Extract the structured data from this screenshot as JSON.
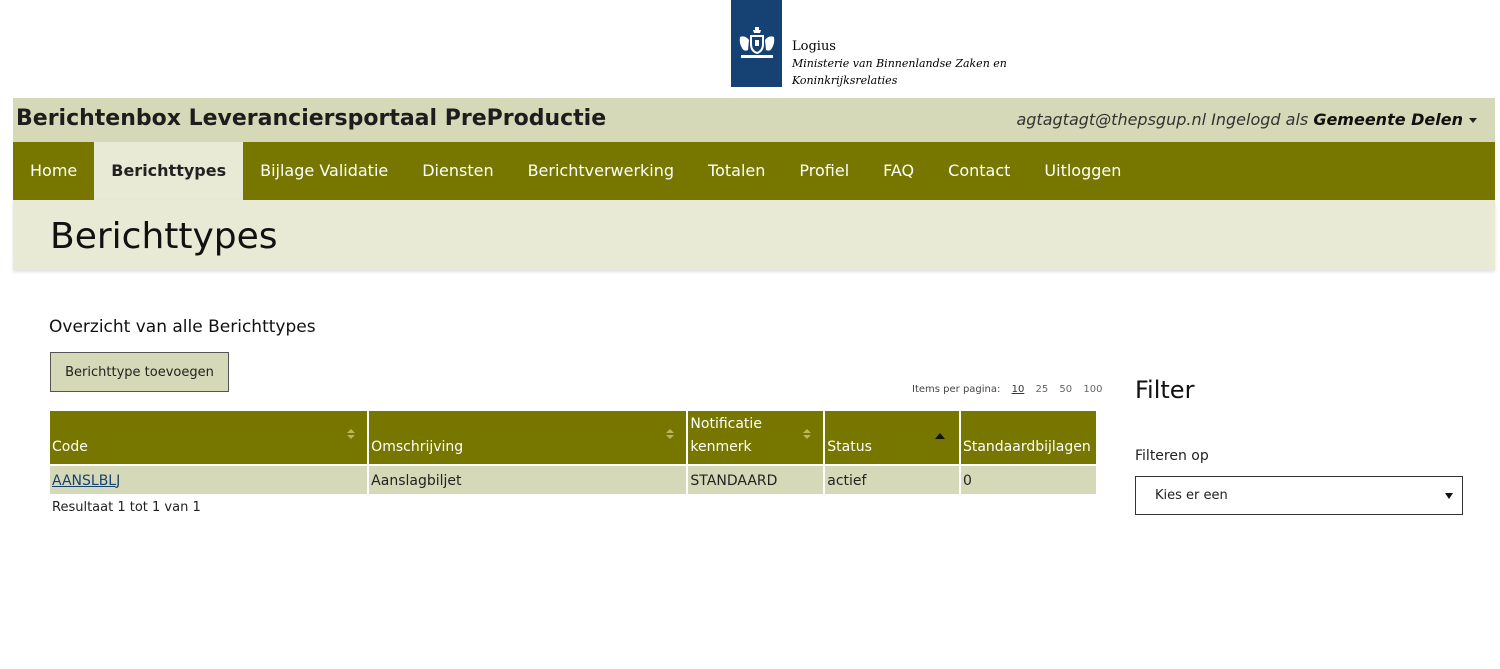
{
  "logo": {
    "icon": "crest-icon",
    "line1": "Logius",
    "line2": "Ministerie van Binnenlandse Zaken en",
    "line3": "Koninkrijksrelaties",
    "color": "#154273"
  },
  "header": {
    "title": "Berichtenbox Leveranciersportaal PreProductie",
    "user_email": "agtagtagt@thepsgup.nl",
    "logged_in_as": "Ingelogd als",
    "organisation": "Gemeente Delen"
  },
  "nav": {
    "items": [
      {
        "label": "Home"
      },
      {
        "label": "Berichttypes",
        "active": true
      },
      {
        "label": "Bijlage Validatie"
      },
      {
        "label": "Diensten"
      },
      {
        "label": "Berichtverwerking"
      },
      {
        "label": "Totalen"
      },
      {
        "label": "Profiel"
      },
      {
        "label": "FAQ"
      },
      {
        "label": "Contact"
      },
      {
        "label": "Uitloggen"
      }
    ],
    "color": "#777700"
  },
  "page": {
    "title": "Berichttypes",
    "section_title": "Overzicht van alle Berichttypes",
    "add_button": "Berichttype toevoegen"
  },
  "pager": {
    "label": "Items per pagina:",
    "options": [
      "10",
      "25",
      "50",
      "100"
    ],
    "selected": "10"
  },
  "table": {
    "columns": {
      "code": "Code",
      "omschrijving": "Omschrijving",
      "notificatie_1": "Notificatie",
      "notificatie_2": "kenmerk",
      "status": "Status",
      "bijlagen": "Standaardbijlagen"
    },
    "rows": [
      {
        "code": "AANSLBLJ",
        "omschrijving": "Aanslagbiljet",
        "kenmerk": "STANDAARD",
        "status": "actief",
        "bijlagen": "0"
      }
    ],
    "result_text": "Resultaat 1 tot 1 van 1"
  },
  "filter": {
    "title": "Filter",
    "label": "Filteren op",
    "selected": "Kies er een"
  }
}
